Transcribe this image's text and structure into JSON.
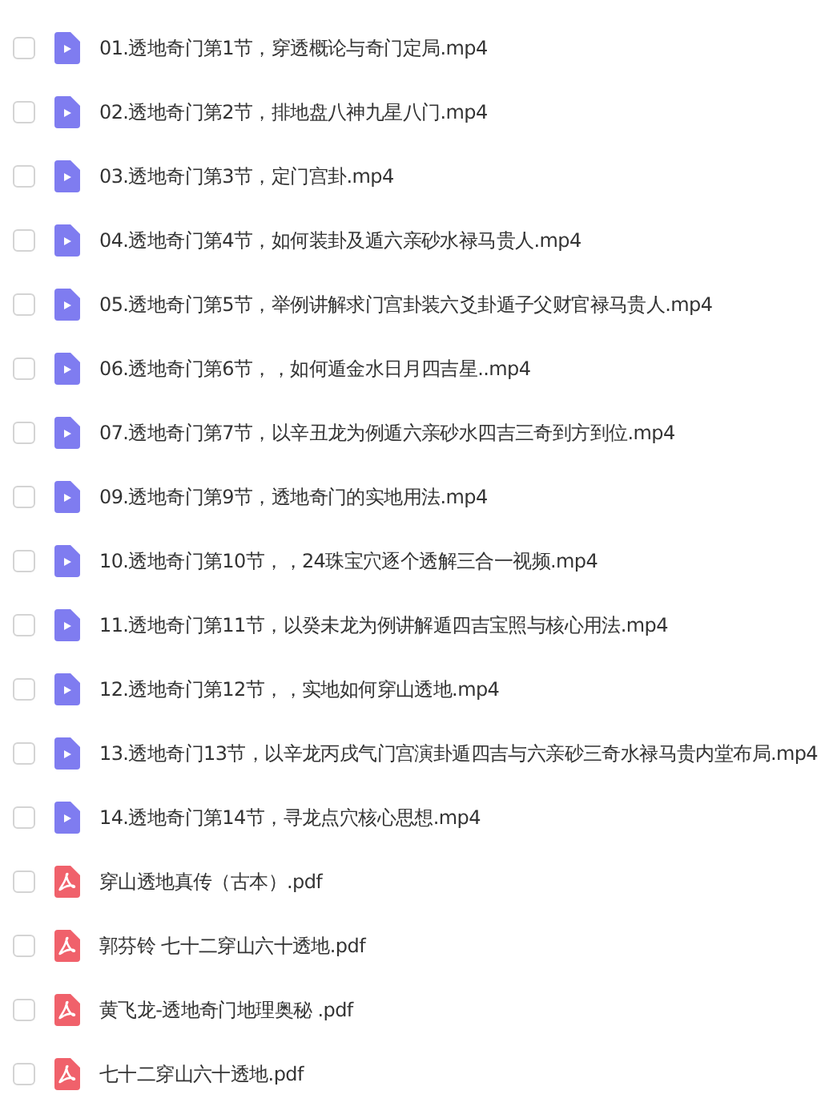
{
  "files": [
    {
      "name": "01.透地奇门第1节，穿透概论与奇门定局.mp4",
      "kind": "video",
      "checked": false
    },
    {
      "name": "02.透地奇门第2节，排地盘八神九星八门.mp4",
      "kind": "video",
      "checked": false
    },
    {
      "name": "03.透地奇门第3节，定门宫卦.mp4",
      "kind": "video",
      "checked": false
    },
    {
      "name": "04.透地奇门第4节，如何装卦及遁六亲砂水禄马贵人.mp4",
      "kind": "video",
      "checked": false
    },
    {
      "name": "05.透地奇门第5节，举例讲解求门宫卦装六爻卦遁子父财官禄马贵人.mp4",
      "kind": "video",
      "checked": false
    },
    {
      "name": "06.透地奇门第6节，，如何遁金水日月四吉星..mp4",
      "kind": "video",
      "checked": false
    },
    {
      "name": "07.透地奇门第7节，以辛丑龙为例遁六亲砂水四吉三奇到方到位.mp4",
      "kind": "video",
      "checked": false
    },
    {
      "name": "09.透地奇门第9节，透地奇门的实地用法.mp4",
      "kind": "video",
      "checked": false
    },
    {
      "name": "10.透地奇门第10节，，24珠宝穴逐个透解三合一视频.mp4",
      "kind": "video",
      "checked": false
    },
    {
      "name": "11.透地奇门第11节，以癸未龙为例讲解遁四吉宝照与核心用法.mp4",
      "kind": "video",
      "checked": false
    },
    {
      "name": "12.透地奇门第12节，，实地如何穿山透地.mp4",
      "kind": "video",
      "checked": false
    },
    {
      "name": "13.透地奇门13节，以辛龙丙戌气门宫演卦遁四吉与六亲砂三奇水禄马贵内堂布局.mp4",
      "kind": "video",
      "checked": false
    },
    {
      "name": "14.透地奇门第14节，寻龙点穴核心思想.mp4",
      "kind": "video",
      "checked": false
    },
    {
      "name": "穿山透地真传（古本）.pdf",
      "kind": "pdf",
      "checked": false
    },
    {
      "name": "郭芬铃 七十二穿山六十透地.pdf",
      "kind": "pdf",
      "checked": false
    },
    {
      "name": "黄飞龙-透地奇门地理奥秘 .pdf",
      "kind": "pdf",
      "checked": false
    },
    {
      "name": "七十二穿山六十透地.pdf",
      "kind": "pdf",
      "checked": false
    }
  ]
}
